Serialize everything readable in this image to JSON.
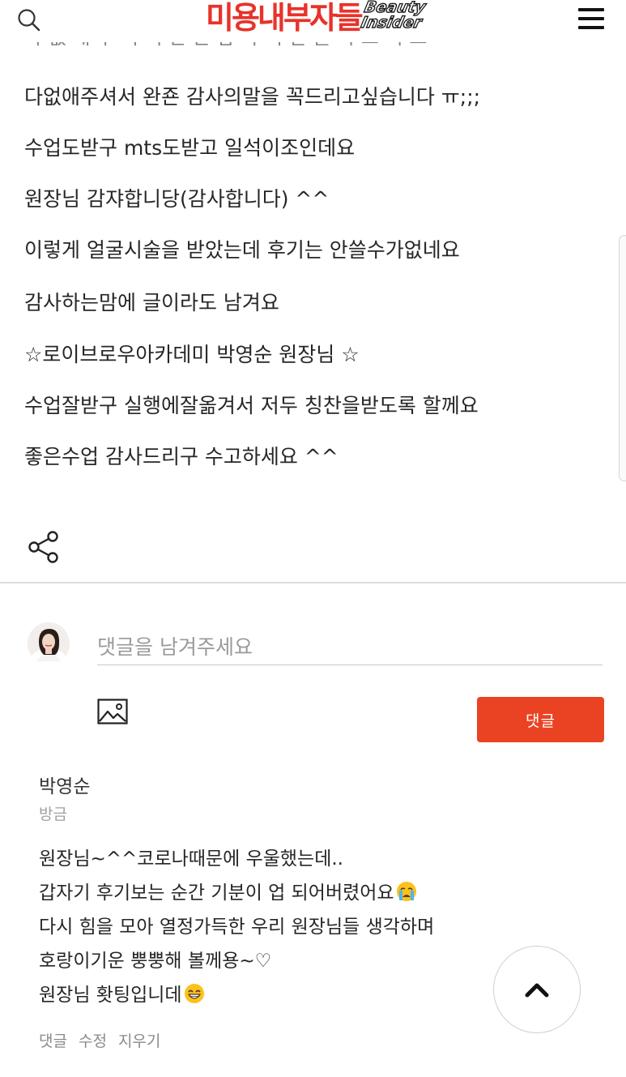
{
  "header": {
    "logo_korean": "미용내부자들",
    "logo_english_line1": "Beauty",
    "logo_english_line2": "Insider",
    "search_icon": "search-icon",
    "menu_icon": "hamburger-menu-icon"
  },
  "article": {
    "lines": [
      "다없애주셔서 완죤 감사의말을 꼭드리고싶습니다 ㅠ;;;",
      "수업도받구 mts도받고 일석이조인데요",
      "원장님 감쟈합니당(감사합니다) ^^",
      "이렇게 얼굴시술을 받았는데 후기는 안쓸수가없네요",
      "감사하는맘에 글이라도 남겨요",
      "☆로이브로우아카데미 박영순 원장님 ☆",
      "수업잘받구 실행에잘옮겨서 저두 칭찬을받도록 할께요",
      "좋은수업 감사드리구 수고하세요 ^^"
    ],
    "share_icon": "share-icon"
  },
  "composer": {
    "placeholder": "댓글을 남겨주세요",
    "image_icon": "image-icon",
    "submit_label": "댓글"
  },
  "comment": {
    "author": "박영순",
    "time": "방금",
    "lines": [
      "원장님~^^코로나때문에 우울했는데..",
      "갑자기 후기보는 순간 기분이 업 되어버렸어요",
      "다시 힘을 모아 열정가득한 우리 원장님들 생각하며",
      "호랑이기운 뿡뿡해 볼께용~♡",
      "원장님 홧팅입니데"
    ],
    "actions": {
      "reply": "댓글",
      "edit": "수정",
      "delete": "지우기"
    }
  },
  "colors": {
    "brand_red": "#e8322a",
    "button_orange": "#ea4323",
    "divider": "#dcdcdc"
  },
  "scroll_top_icon": "chevron-up-icon"
}
